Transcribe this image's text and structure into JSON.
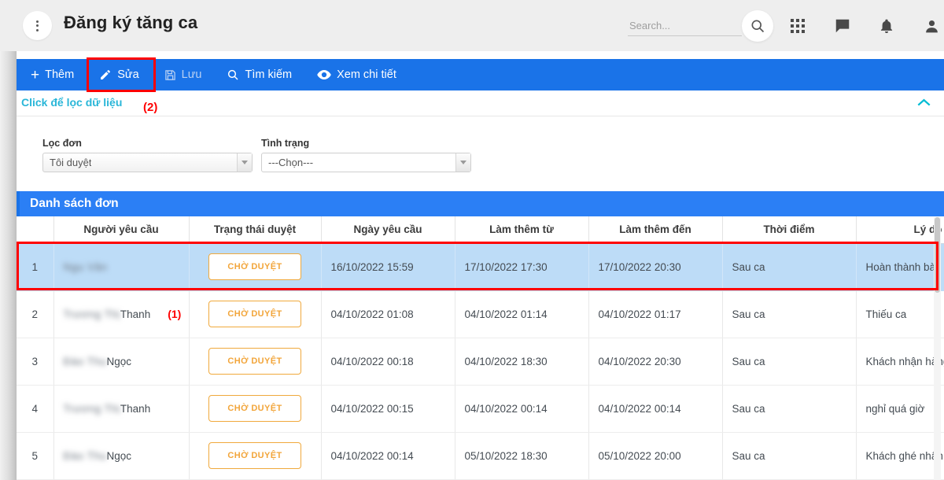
{
  "header": {
    "title": "Đăng ký tăng ca",
    "menu_icon": "kebab-menu-icon",
    "search_placeholder": "Search...",
    "search_value": "",
    "icons": [
      "search-icon",
      "apps-grid-icon",
      "chat-icon",
      "bell-icon",
      "person-icon"
    ]
  },
  "toolbar": {
    "items": [
      {
        "label": "Thêm",
        "icon": "plus-icon",
        "state": "enabled"
      },
      {
        "label": "Sửa",
        "icon": "pencil-icon",
        "state": "enabled"
      },
      {
        "label": "Lưu",
        "icon": "save-icon",
        "state": "disabled"
      },
      {
        "label": "Tìm kiếm",
        "icon": "search-icon",
        "state": "enabled"
      },
      {
        "label": "Xem chi tiết",
        "icon": "eye-icon",
        "state": "enabled"
      }
    ],
    "accent_color": "#1a73e8"
  },
  "filter": {
    "toggle_label": "Click để lọc dữ liệu",
    "toggle_color": "#29b6d8",
    "collapse_icon": "chevron-up-icon",
    "fields": [
      {
        "label": "Lọc đơn",
        "value": "Tôi duyệt"
      },
      {
        "label": "Tình trạng",
        "value": "---Chọn---"
      }
    ]
  },
  "list": {
    "title": "Danh sách đơn",
    "columns": [
      "",
      "Người yêu cầu",
      "Trạng thái duyệt",
      "Ngày yêu cầu",
      "Làm thêm từ",
      "Làm thêm đến",
      "Thời điểm",
      "Lý do"
    ],
    "rows": [
      {
        "index": "1",
        "requester_blurred": "Ngu Vân",
        "requester_visible": "",
        "status": "CHỜ DUYỆT",
        "request_date": "16/10/2022 15:59",
        "ot_from": "17/10/2022 17:30",
        "ot_to": "17/10/2022 20:30",
        "moment": "Sau ca",
        "reason": "Hoàn thành bàn giao",
        "selected": true
      },
      {
        "index": "2",
        "requester_blurred": "Trương Thị",
        "requester_visible": "Thanh",
        "status": "CHỜ DUYỆT",
        "request_date": "04/10/2022 01:08",
        "ot_from": "04/10/2022 01:14",
        "ot_to": "04/10/2022 01:17",
        "moment": "Sau ca",
        "reason": "Thiếu ca",
        "selected": false
      },
      {
        "index": "3",
        "requester_blurred": "Đào Thu",
        "requester_visible": "Ngọc",
        "status": "CHỜ DUYỆT",
        "request_date": "04/10/2022 00:18",
        "ot_from": "04/10/2022 18:30",
        "ot_to": "04/10/2022 20:30",
        "moment": "Sau ca",
        "reason": "Khách nhận hàng",
        "selected": false
      },
      {
        "index": "4",
        "requester_blurred": "Trương Thị",
        "requester_visible": "Thanh",
        "status": "CHỜ DUYỆT",
        "request_date": "04/10/2022 00:15",
        "ot_from": "04/10/2022 00:14",
        "ot_to": "04/10/2022 00:14",
        "moment": "Sau ca",
        "reason": "nghỉ quá giờ",
        "selected": false
      },
      {
        "index": "5",
        "requester_blurred": "Đào Thu",
        "requester_visible": "Ngọc",
        "status": "CHỜ DUYỆT",
        "request_date": "04/10/2022 00:14",
        "ot_from": "05/10/2022 18:30",
        "ot_to": "05/10/2022 20:00",
        "moment": "Sau ca",
        "reason": "Khách ghé nhận",
        "selected": false
      }
    ],
    "status_badge_color": "#f2a53a",
    "selected_row_color": "#bddcf7"
  },
  "annotations": {
    "marker_1": "(1)",
    "marker_2": "(2)",
    "color": "#ff0000"
  }
}
